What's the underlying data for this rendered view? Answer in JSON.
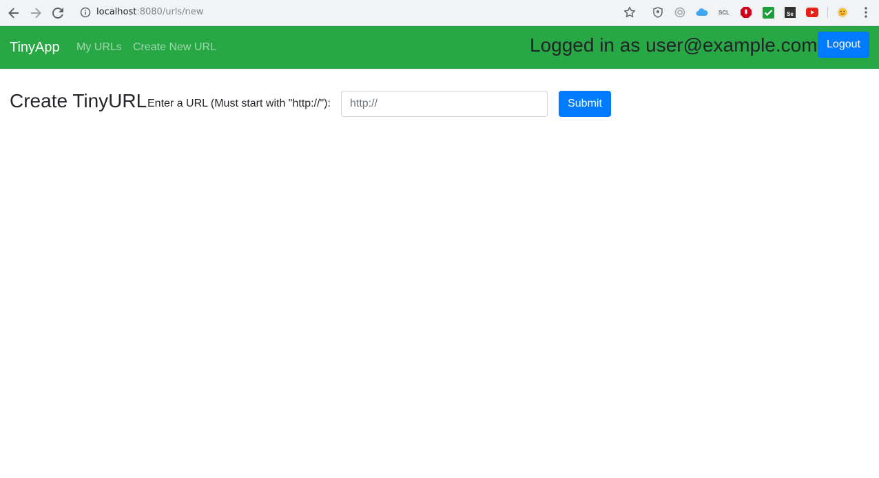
{
  "browser": {
    "url_host": "localhost",
    "url_rest": ":8080/urls/new",
    "icons": [
      "back-arrow-icon",
      "forward-arrow-icon",
      "reload-icon",
      "info-icon",
      "bookmark-star-icon",
      "shield-extension-icon",
      "circle-extension-icon",
      "cloud-extension-icon",
      "scl-extension-icon",
      "stop-hand-extension-icon",
      "checkmark-extension-icon",
      "selenium-extension-icon",
      "youtube-extension-icon",
      "profile-avatar-icon",
      "menu-kebab-icon"
    ],
    "ext_scl_label": "SCL",
    "ext_se_label": "Se"
  },
  "navbar": {
    "brand": "TinyApp",
    "links": [
      "My URLs",
      "Create New URL"
    ],
    "logged_in_text": "Logged in as user@example.com",
    "logout_label": "Logout",
    "color": "#28a745"
  },
  "main": {
    "title": "Create TinyURL",
    "form_label": "Enter a URL (Must start with \"http://\"):",
    "input_placeholder": "http://",
    "input_value": "",
    "submit_label": "Submit",
    "button_color": "#007bff"
  }
}
